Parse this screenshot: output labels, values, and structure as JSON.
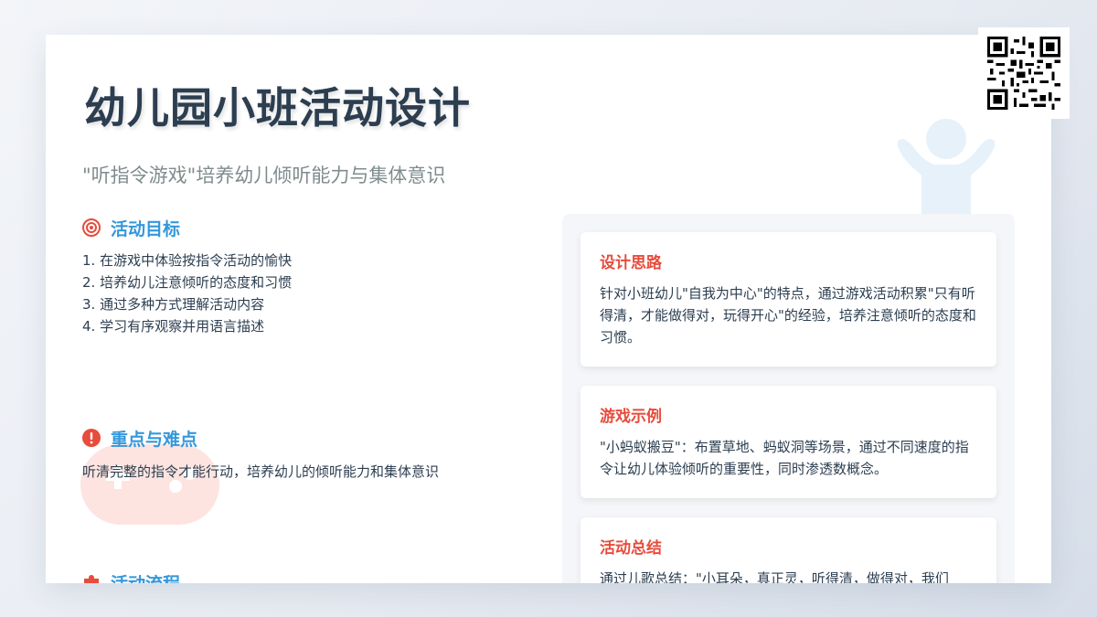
{
  "title": "幼儿园小班活动设计",
  "subtitle": "\"听指令游戏\"培养幼儿倾听能力与集体意识",
  "goals": {
    "icon": "target-icon",
    "heading": "活动目标",
    "items": [
      "1. 在游戏中体验按指令活动的愉快",
      "2. 培养幼儿注意倾听的态度和习惯",
      "3. 通过多种方式理解活动内容",
      "4. 学习有序观察并用语言描述"
    ]
  },
  "focus": {
    "icon": "exclamation-icon",
    "heading": "重点与难点",
    "text": "听清完整的指令才能行动，培养幼儿的倾听能力和集体意识"
  },
  "process": {
    "icon": "puzzle-icon",
    "heading": "活动流程"
  },
  "cards": [
    {
      "title": "设计思路",
      "text": "针对小班幼儿\"自我为中心\"的特点，通过游戏活动积累\"只有听得清，才能做得对，玩得开心\"的经验，培养注意倾听的态度和习惯。"
    },
    {
      "title": "游戏示例",
      "text": "\"小蚂蚁搬豆\"：布置草地、蚂蚁洞等场景，通过不同速度的指令让幼儿体验倾听的重要性，同时渗透数概念。"
    },
    {
      "title": "活动总结",
      "text": "通过儿歌总结：\"小耳朵，真正灵，听得清，做得对，我们"
    }
  ],
  "colors": {
    "title": "#2c3e50",
    "accent_blue": "#3498db",
    "accent_red": "#e74c3c",
    "subtitle": "#7f8c8d"
  }
}
